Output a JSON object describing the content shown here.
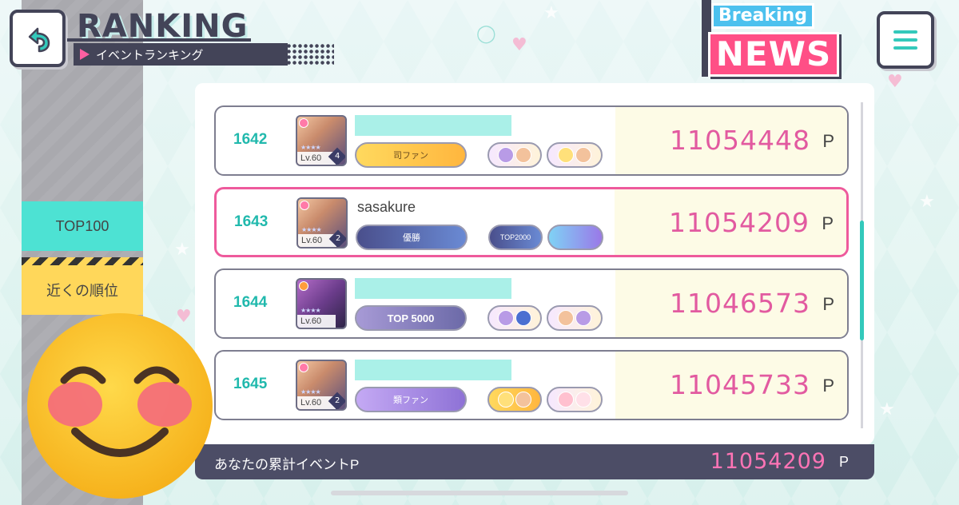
{
  "header": {
    "title": "RANKING",
    "subtitle": "イベントランキング",
    "news_breaking": "Breaking",
    "news_news": "NEWS"
  },
  "icons": {
    "back": "back-arrow-icon",
    "menu": "hamburger-menu-icon"
  },
  "sidebar": {
    "tabs": [
      {
        "label": "TOP100"
      },
      {
        "label": "近くの順位"
      }
    ]
  },
  "ranking": {
    "rows": [
      {
        "rank": "1642",
        "name": "",
        "level": "Lv.60",
        "mastery": "4",
        "honor_main": "司ファン",
        "score": "11054448",
        "unit": "P"
      },
      {
        "rank": "1643",
        "name": "sasakure",
        "level": "Lv.60",
        "mastery": "2",
        "honor_main": "優勝",
        "honor_sub": "TOP2000",
        "score": "11054209",
        "unit": "P"
      },
      {
        "rank": "1644",
        "name": "",
        "level": "Lv.60",
        "mastery": "",
        "honor_main": "TOP 5000",
        "score": "11046573",
        "unit": "P"
      },
      {
        "rank": "1645",
        "name": "",
        "level": "Lv.60",
        "mastery": "2",
        "honor_main": "類ファン",
        "score": "11045733",
        "unit": "P"
      }
    ]
  },
  "footer": {
    "label": "あなたの累計イベントP",
    "total": "11054209",
    "unit": "P"
  },
  "colors": {
    "accent_teal": "#33c9bb",
    "score_pink": "#e25aa0",
    "dark": "#434458",
    "highlight_border": "#ee5a9c"
  }
}
